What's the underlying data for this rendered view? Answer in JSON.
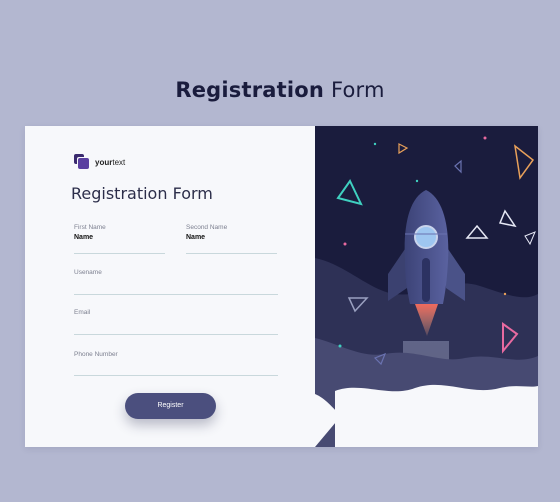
{
  "page": {
    "heading_bold": "Registration",
    "heading_light": "Form"
  },
  "brand": {
    "name_bold": "your",
    "name_light": "text"
  },
  "form": {
    "title": "Registration Form",
    "fields": {
      "first_name": {
        "label": "First Name",
        "value": "Name"
      },
      "second_name": {
        "label": "Second Name",
        "value": "Name"
      },
      "username": {
        "label": "Usename",
        "value": ""
      },
      "email": {
        "label": "Email",
        "value": ""
      },
      "phone": {
        "label": "Phone Number",
        "value": ""
      }
    },
    "register_label": "Register"
  },
  "illustration": {
    "subject": "rocket-launch",
    "colors": {
      "background": "#1a1c3d",
      "rocket": "#4a5288",
      "flame": "#f06a5c",
      "triangle_teal": "#3fd0c0",
      "triangle_pink": "#e86aa0",
      "triangle_orange": "#e8a05a",
      "triangle_white": "#e6e8f5"
    }
  }
}
